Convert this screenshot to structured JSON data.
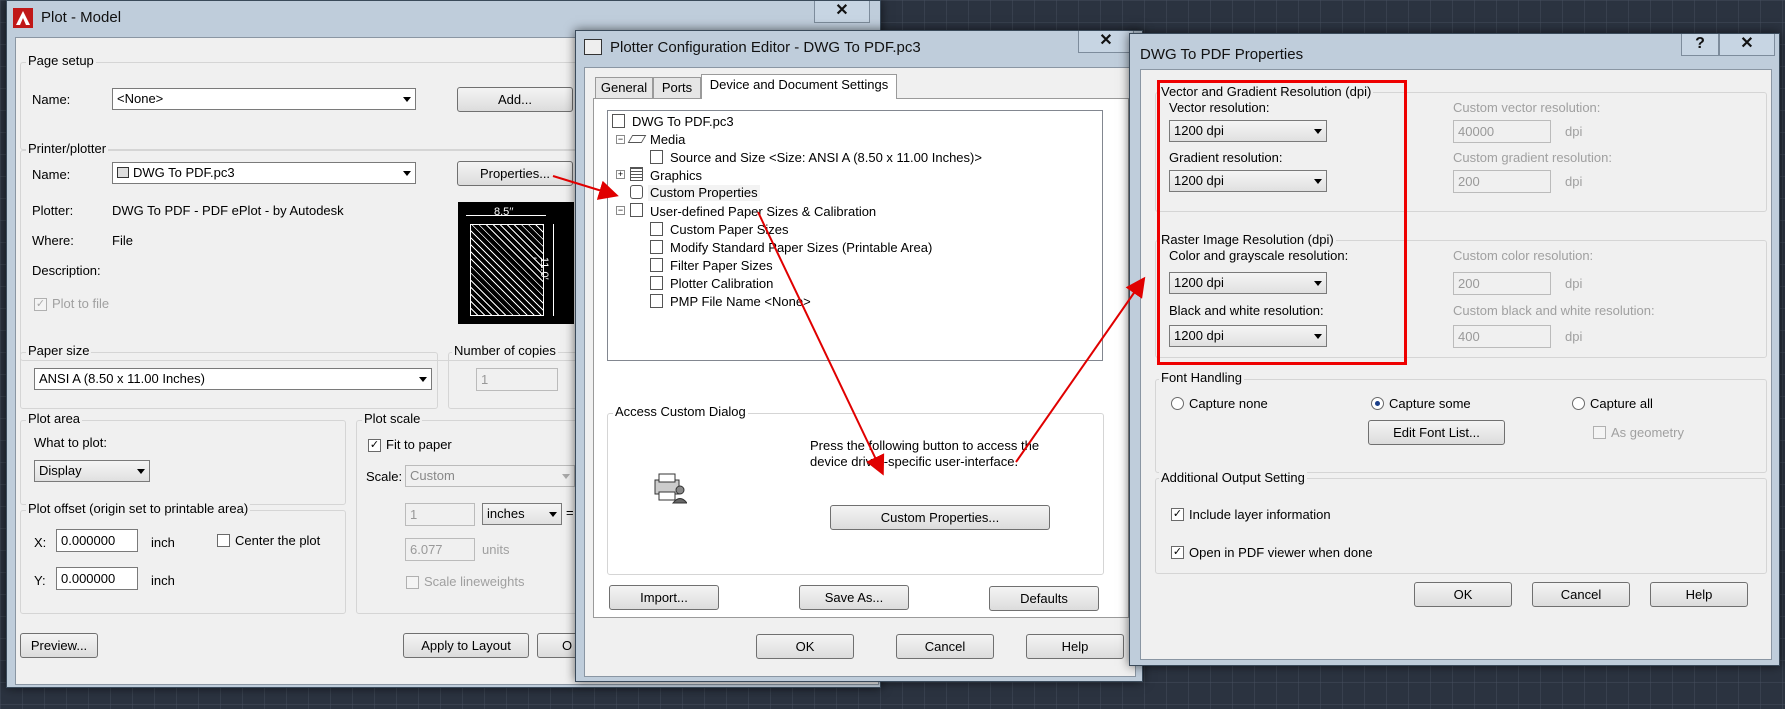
{
  "plot": {
    "title": "Plot - Model",
    "page_setup_group": "Page setup",
    "name_label": "Name:",
    "page_setup_name": "<None>",
    "add_button": "Add...",
    "printer_group": "Printer/plotter",
    "printer_name_label": "Name:",
    "printer_name": "DWG To PDF.pc3",
    "properties_button": "Properties...",
    "plotter_label": "Plotter:",
    "plotter_value": "DWG To PDF - PDF ePlot - by Autodesk",
    "where_label": "Where:",
    "where_value": "File",
    "description_label": "Description:",
    "plot_to_file_label": "Plot to file",
    "preview_width": "8.5′′",
    "preview_height": "11.0′′",
    "paper_size_group": "Paper size",
    "paper_size_value": "ANSI A (8.50 x 11.00 Inches)",
    "copies_group": "Number of copies",
    "copies_value": "1",
    "plot_area_group": "Plot area",
    "what_to_plot_label": "What to plot:",
    "what_to_plot_value": "Display",
    "plot_offset_group": "Plot offset (origin set to printable area)",
    "x_label": "X:",
    "x_value": "0.000000",
    "x_unit": "inch",
    "y_label": "Y:",
    "y_value": "0.000000",
    "y_unit": "inch",
    "center_plot_label": "Center the plot",
    "plot_scale_group": "Plot scale",
    "fit_to_paper_label": "Fit to paper",
    "scale_label": "Scale:",
    "scale_value": "Custom",
    "scale_num": "1",
    "scale_units": "inches",
    "scale_eq": "=",
    "scale_den": "6.077",
    "scale_den_units": "units",
    "scale_lineweights_label": "Scale lineweights",
    "preview_button": "Preview...",
    "apply_layout_button": "Apply to Layout",
    "ok_button": "O"
  },
  "pce": {
    "title": "Plotter Configuration Editor - DWG To PDF.pc3",
    "tabs": [
      "General",
      "Ports",
      "Device and Document Settings"
    ],
    "tree": [
      "DWG To PDF.pc3",
      "Media",
      "Source and Size <Size: ANSI A (8.50 x 11.00 Inches)>",
      "Graphics",
      "Custom Properties",
      "User-defined Paper Sizes & Calibration",
      "Custom Paper Sizes",
      "Modify Standard Paper Sizes (Printable Area)",
      "Filter Paper Sizes",
      "Plotter Calibration",
      "PMP File Name <None>"
    ],
    "access_group": "Access Custom Dialog",
    "access_text_1": "Press the following button to access the",
    "access_text_2": "device driver-specific user-interface.",
    "custom_properties_button": "Custom Properties...",
    "import_button": "Import...",
    "save_as_button": "Save As...",
    "defaults_button": "Defaults",
    "ok_button": "OK",
    "cancel_button": "Cancel",
    "help_button": "Help"
  },
  "pdf": {
    "title": "DWG To PDF Properties",
    "help_glyph": "?",
    "vector_group": "Vector and Gradient Resolution (dpi)",
    "vector_label": "Vector resolution:",
    "vector_value": "1200 dpi",
    "custom_vector_label": "Custom vector resolution:",
    "custom_vector_value": "40000",
    "gradient_label": "Gradient resolution:",
    "gradient_value": "1200 dpi",
    "custom_gradient_label": "Custom gradient resolution:",
    "custom_gradient_value": "200",
    "raster_group": "Raster Image Resolution (dpi)",
    "color_label": "Color and grayscale resolution:",
    "color_value": "1200 dpi",
    "custom_color_label": "Custom color resolution:",
    "custom_color_value": "200",
    "bw_label": "Black and white resolution:",
    "bw_value": "1200 dpi",
    "custom_bw_label": "Custom black and white resolution:",
    "custom_bw_value": "400",
    "dpi_unit": "dpi",
    "font_group": "Font Handling",
    "capture_none": "Capture none",
    "capture_some": "Capture some",
    "capture_all": "Capture all",
    "edit_font_button": "Edit Font List...",
    "as_geometry": "As geometry",
    "additional_group": "Additional Output Setting",
    "include_layer": "Include layer information",
    "open_pdf": "Open in PDF viewer when done",
    "ok_button": "OK",
    "cancel_button": "Cancel",
    "help_button": "Help"
  },
  "common": {
    "close_glyph": "✕",
    "check_glyph": "✓"
  },
  "colors": {
    "annotation_red": "#e00000",
    "title_bar": "#bfcddb",
    "dialog_bg": "#f0f0f0"
  }
}
